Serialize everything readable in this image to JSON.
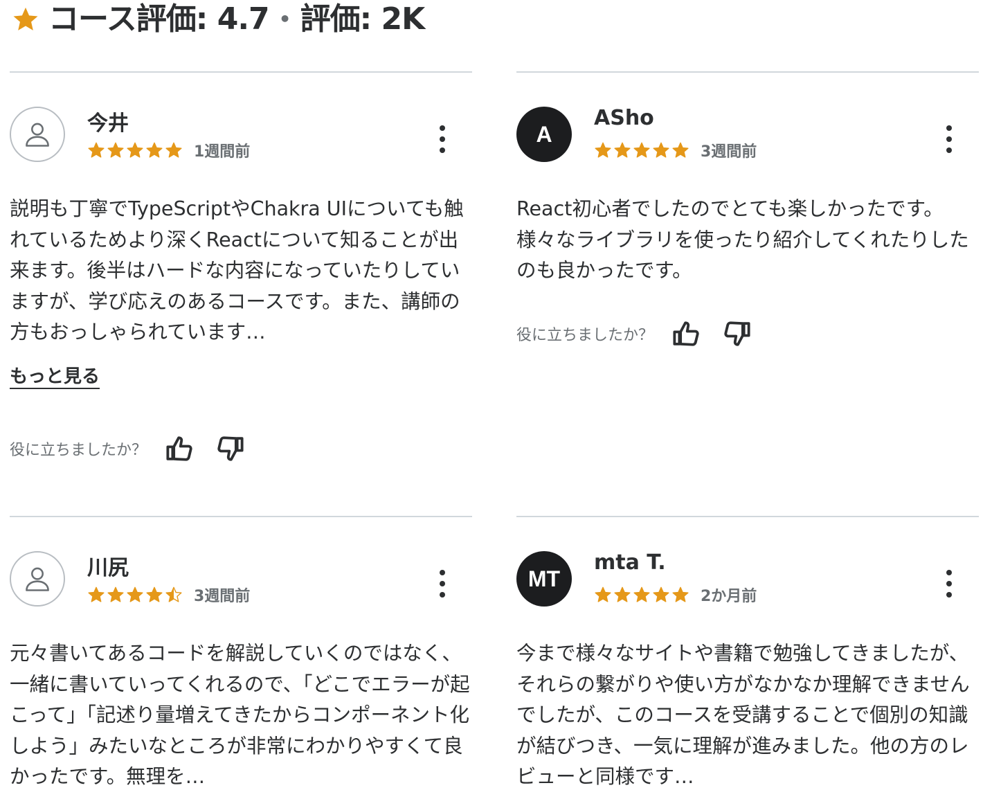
{
  "header": {
    "star_icon": "star-icon",
    "course_rating": "コース評価: 4.7",
    "separator": "•",
    "rating_count": "評価: 2K"
  },
  "colors": {
    "star": "#e59819",
    "text": "#2d2f31",
    "muted": "#6a6f73",
    "divider": "#d1d7dc",
    "avatar_dark": "#1c1d1f"
  },
  "reviews": [
    {
      "name": "今井",
      "avatar_type": "placeholder",
      "avatar_text": "",
      "rating": 5,
      "date": "1週間前",
      "text": "説明も丁寧でTypeScriptやChakra UIについても触れているためより深くReactについて知ることが出来ます。後半はハードな内容になっていたりしていますが、学び応えのあるコースです。また、講師の方もおっしゃられています…",
      "more_label": "もっと見る",
      "helpful_label": "役に立ちましたか？"
    },
    {
      "name": "ASho",
      "avatar_type": "initials",
      "avatar_text": "A",
      "rating": 5,
      "date": "3週間前",
      "text": "React初心者でしたのでとても楽しかったです。様々なライブラリを使ったり紹介してくれたりしたのも良かったです。",
      "helpful_label": "役に立ちましたか？"
    },
    {
      "name": "川尻",
      "avatar_type": "placeholder",
      "avatar_text": "",
      "rating": 4.5,
      "date": "3週間前",
      "text": "元々書いてあるコードを解説していくのではなく、一緒に書いていってくれるので、「どこでエラーが起こって」「記述り量増えてきたからコンポーネント化しよう」みたいなところが非常にわかりやすくて良かったです。無理を…"
    },
    {
      "name": "mta T.",
      "avatar_type": "initials",
      "avatar_text": "MT",
      "rating": 5,
      "date": "2か月前",
      "text": "今まで様々なサイトや書籍で勉強してきましたが、それらの繋がりや使い方がなかなか理解できませんでしたが、このコースを受講することで個別の知識が結びつき、一気に理解が進みました。他の方のレビューと同様です…"
    }
  ]
}
